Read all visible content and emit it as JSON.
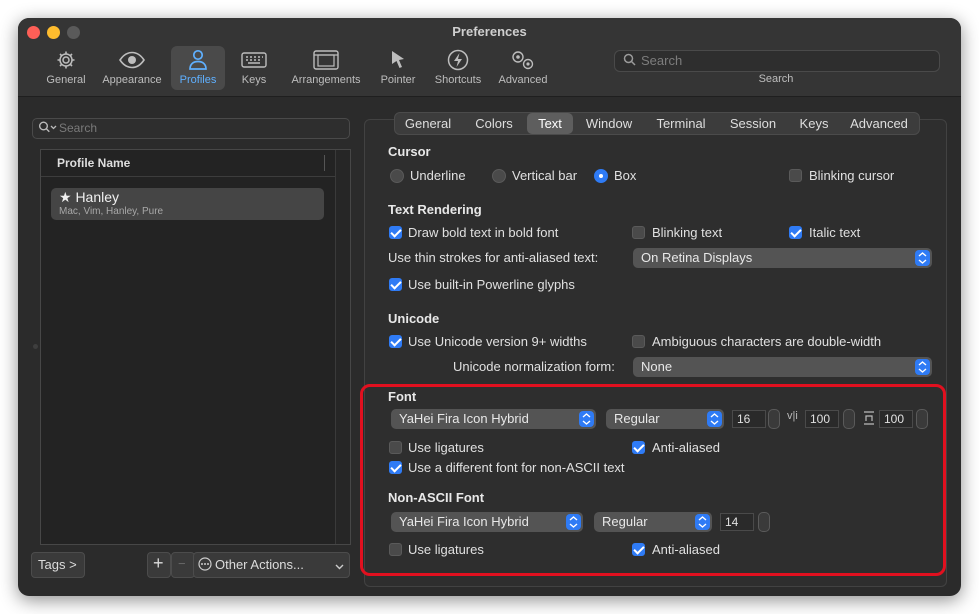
{
  "window": {
    "title": "Preferences"
  },
  "toolbar": {
    "items": [
      {
        "label": "General",
        "icon": "gear-icon"
      },
      {
        "label": "Appearance",
        "icon": "eye-icon"
      },
      {
        "label": "Profiles",
        "icon": "person-icon"
      },
      {
        "label": "Keys",
        "icon": "keyboard-icon"
      },
      {
        "label": "Arrangements",
        "icon": "windows-icon"
      },
      {
        "label": "Pointer",
        "icon": "pointer-icon"
      },
      {
        "label": "Shortcuts",
        "icon": "lightning-icon"
      },
      {
        "label": "Advanced",
        "icon": "gears-icon"
      }
    ],
    "selected": "Profiles",
    "search_placeholder": "Search",
    "search_caption": "Search"
  },
  "profiles": {
    "search_placeholder": "Search",
    "column_header": "Profile Name",
    "items": [
      {
        "name": "★ Hanley",
        "tags": "Mac, Vim, Hanley, Pure"
      }
    ]
  },
  "bottom": {
    "tags_label": "Tags >",
    "add_label": "+",
    "remove_label": "−",
    "other_actions_label": "Other Actions..."
  },
  "tabs": [
    "General",
    "Colors",
    "Text",
    "Window",
    "Terminal",
    "Session",
    "Keys",
    "Advanced"
  ],
  "selected_tab": "Text",
  "cursor": {
    "heading": "Cursor",
    "options": [
      "Underline",
      "Vertical bar",
      "Box"
    ],
    "selected": "Box",
    "blinking_label": "Blinking cursor",
    "blinking": false
  },
  "text_rendering": {
    "heading": "Text Rendering",
    "bold_label": "Draw bold text in bold font",
    "blinking_text_label": "Blinking text",
    "italic_label": "Italic text",
    "thin_strokes_label": "Use thin strokes for anti-aliased text:",
    "thin_strokes_value": "On Retina Displays",
    "powerline_label": "Use built-in Powerline glyphs"
  },
  "unicode": {
    "heading": "Unicode",
    "v9_label": "Use Unicode version 9+ widths",
    "ambiguous_label": "Ambiguous characters are double-width",
    "normalization_label": "Unicode normalization form:",
    "normalization_value": "None"
  },
  "font": {
    "heading": "Font",
    "family": "YaHei Fira Icon Hybrid",
    "weight": "Regular",
    "size": "16",
    "h_spacing": "100",
    "v_spacing": "100",
    "ligatures_label": "Use ligatures",
    "antialiased_label": "Anti-aliased",
    "non_ascii_label": "Use a different font for non-ASCII text"
  },
  "non_ascii_font": {
    "heading": "Non-ASCII Font",
    "family": "YaHei Fira Icon Hybrid",
    "weight": "Regular",
    "size": "14",
    "ligatures_label": "Use ligatures",
    "antialiased_label": "Anti-aliased"
  },
  "colors": {
    "accent": "#2f7bf5",
    "highlight": "#e1101f",
    "selected_tool": "#5fb0ff"
  }
}
